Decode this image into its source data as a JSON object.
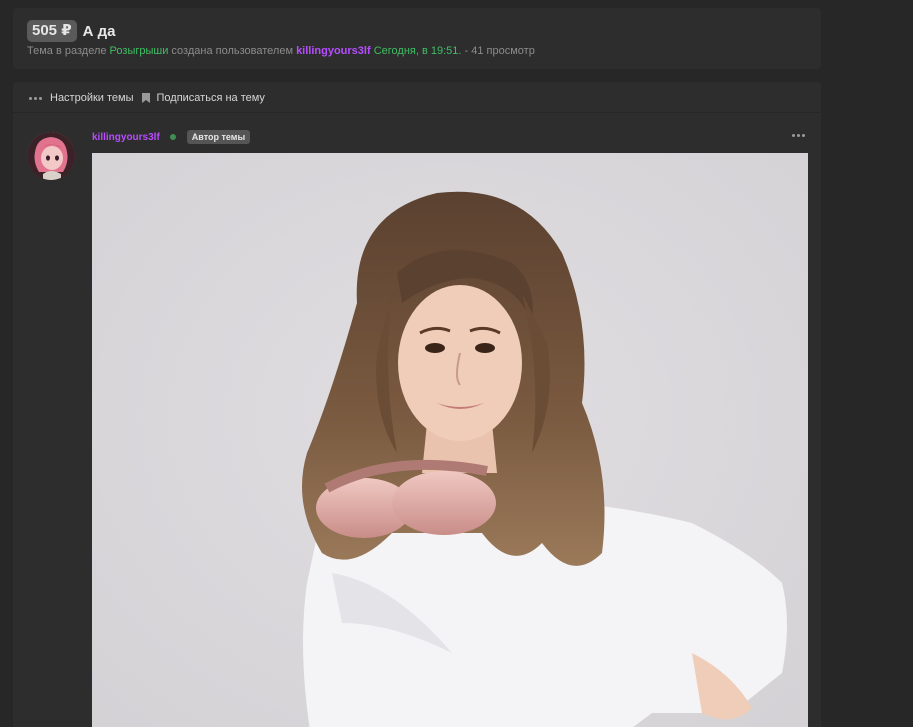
{
  "header": {
    "price": "505 ₽",
    "title": "А да",
    "meta_prefix": "Тема в разделе ",
    "section": "Розыгрыши",
    "meta_created_by": " создана пользователем ",
    "author": "killingyours3lf",
    "time": " Сегодня, в 19:51.",
    "views": "  - 41 просмотр"
  },
  "actions": {
    "settings_label": "Настройки темы",
    "subscribe_label": "Подписаться на тему"
  },
  "post": {
    "username": "killingyours3lf",
    "author_badge": "Автор темы",
    "online_color": "#3f8f55",
    "image_alt": "Фото"
  },
  "colors": {
    "background": "#272727",
    "panel": "#2d2d2d",
    "accent_green": "#3fbf65",
    "accent_purple": "#b74dff"
  }
}
